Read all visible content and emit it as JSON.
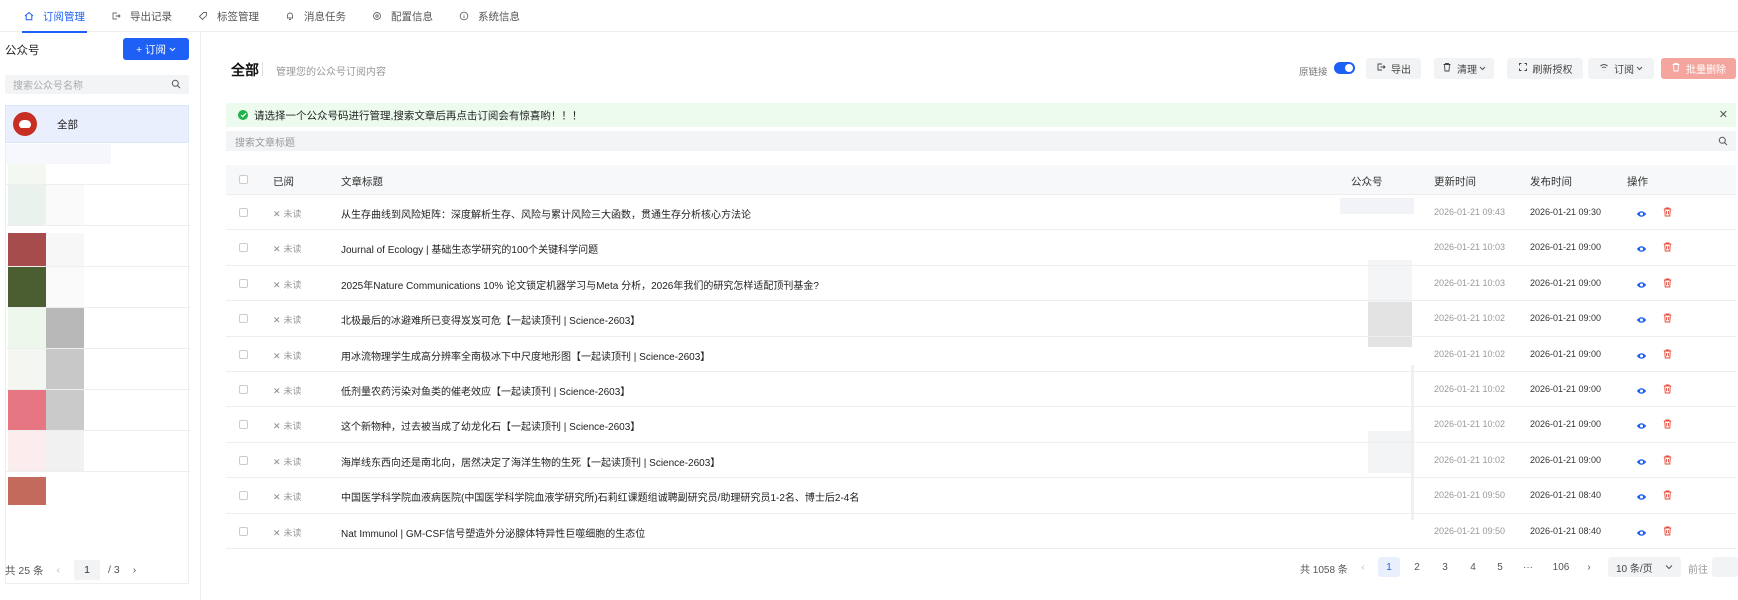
{
  "nav": {
    "tabs": [
      {
        "label": "订阅管理",
        "icon": "home-icon",
        "active": true
      },
      {
        "label": "导出记录",
        "icon": "export-icon",
        "active": false
      },
      {
        "label": "标签管理",
        "icon": "tag-icon",
        "active": false
      },
      {
        "label": "消息任务",
        "icon": "bell-icon",
        "active": false
      },
      {
        "label": "配置信息",
        "icon": "gear-icon",
        "active": false
      },
      {
        "label": "系统信息",
        "icon": "info-icon",
        "active": false
      }
    ]
  },
  "sidebar": {
    "title": "公众号",
    "subscribe_button": "+ 订阅",
    "search_placeholder": "搜索公众号名称",
    "all_label": "全部",
    "pager": {
      "total": "共 25 条",
      "page": "1",
      "pages": "/ 3"
    }
  },
  "main": {
    "title": "全部",
    "subtitle": "管理您的公众号订阅内容",
    "toolbar": {
      "source_link_label": "原链接",
      "export": "导出",
      "clear": "清理",
      "refresh_auth": "刷新授权",
      "subscribe": "订阅",
      "batch_delete": "批量删除"
    },
    "alert": "请选择一个公众号码进行管理,搜索文章后再点击订阅会有惊喜哟！！！",
    "search_placeholder": "搜索文章标题"
  },
  "table": {
    "headers": {
      "read": "已阅",
      "title": "文章标题",
      "account": "公众号",
      "updated": "更新时间",
      "published": "发布时间",
      "actions": "操作"
    },
    "rows": [
      {
        "read": "未读",
        "title": "从生存曲线到风险矩阵：深度解析生存、风险与累计风险三大函数，贯通生存分析核心方法论",
        "updated": "2026-01-21 09:43",
        "published": "2026-01-21 09:30"
      },
      {
        "read": "未读",
        "title": "Journal of Ecology | 基础生态学研究的100个关键科学问题",
        "updated": "2026-01-21 10:03",
        "published": "2026-01-21 09:00"
      },
      {
        "read": "未读",
        "title": "2025年Nature Communications 10% 论文锁定机器学习与Meta 分析，2026年我们的研究怎样适配顶刊基金?",
        "updated": "2026-01-21 10:03",
        "published": "2026-01-21 09:00"
      },
      {
        "read": "未读",
        "title": "北极最后的冰避难所已变得岌岌可危【一起读顶刊 | Science-2603】",
        "updated": "2026-01-21 10:02",
        "published": "2026-01-21 09:00"
      },
      {
        "read": "未读",
        "title": "用冰流物理学生成高分辨率全南极冰下中尺度地形图【一起读顶刊 | Science-2603】",
        "updated": "2026-01-21 10:02",
        "published": "2026-01-21 09:00"
      },
      {
        "read": "未读",
        "title": "低剂量农药污染对鱼类的催老效应【一起读顶刊 | Science-2603】",
        "updated": "2026-01-21 10:02",
        "published": "2026-01-21 09:00"
      },
      {
        "read": "未读",
        "title": "这个新物种，过去被当成了幼龙化石【一起读顶刊 | Science-2603】",
        "updated": "2026-01-21 10:02",
        "published": "2026-01-21 09:00"
      },
      {
        "read": "未读",
        "title": "海岸线东西向还是南北向，居然决定了海洋生物的生死【一起读顶刊 | Science-2603】",
        "updated": "2026-01-21 10:02",
        "published": "2026-01-21 09:00"
      },
      {
        "read": "未读",
        "title": "中国医学科学院血液病医院(中国医学科学院血液学研究所)石莉红课题组诚聘副研究员/助理研究员1-2名、博士后2-4名",
        "updated": "2026-01-21 09:50",
        "published": "2026-01-21 08:40"
      },
      {
        "read": "未读",
        "title": "Nat Immunol | GM-CSF信号塑造外分泌腺体特异性巨噬细胞的生态位",
        "updated": "2026-01-21 09:50",
        "published": "2026-01-21 08:40"
      }
    ]
  },
  "pager": {
    "total": "共 1058 条",
    "pages": [
      "1",
      "2",
      "3",
      "4",
      "5",
      "···",
      "106"
    ],
    "size": "10 条/页",
    "goto": "前往"
  },
  "colors": {
    "accent": "#1e5ff5",
    "success": "#21b24b",
    "danger": "#e5493a"
  }
}
